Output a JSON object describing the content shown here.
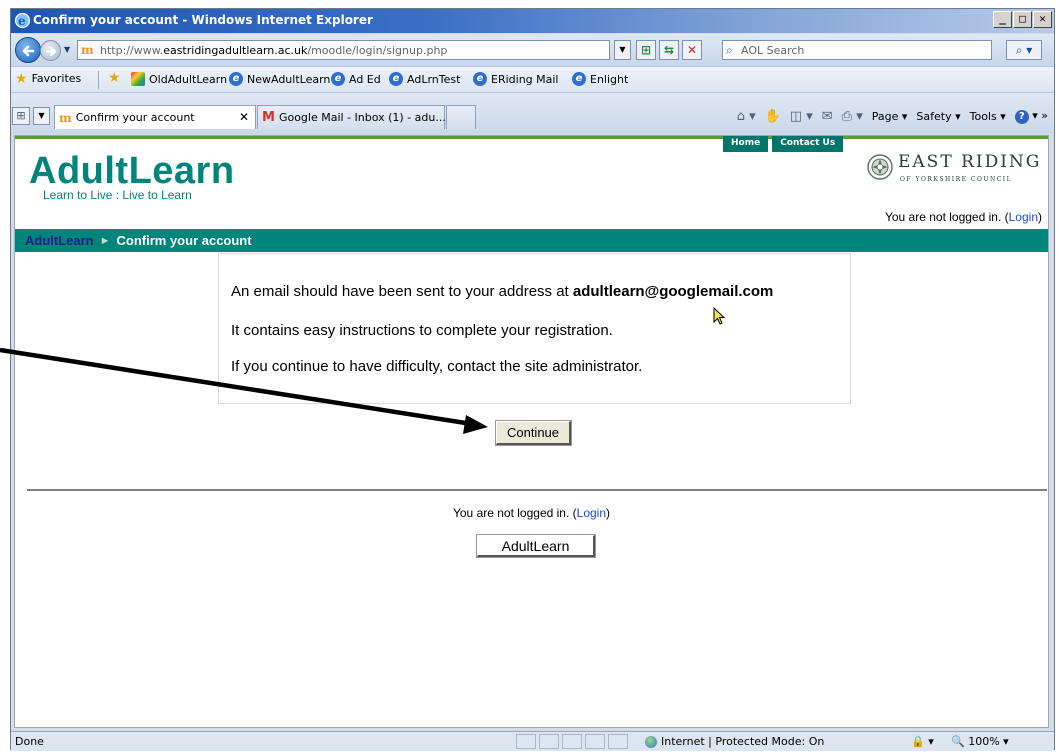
{
  "window": {
    "title": "Confirm your account - Windows Internet Explorer",
    "min_label": "_",
    "max_label": "□",
    "close_label": "✕"
  },
  "address_bar": {
    "url_prefix": "http://www.",
    "url_domain": "eastridingadultlearn.ac.uk",
    "url_path": "/moodle/login/signup.php",
    "search_placeholder": "AOL Search"
  },
  "favorites_bar": {
    "favorites_label": "Favorites",
    "items": [
      {
        "label": "OldAdultLearn",
        "icon": "colorful-icon"
      },
      {
        "label": "NewAdultLearn",
        "icon": "ie-icon"
      },
      {
        "label": "Ad Ed",
        "icon": "ie-icon"
      },
      {
        "label": "AdLrnTest",
        "icon": "ie-icon"
      },
      {
        "label": "ERiding Mail",
        "icon": "ie-icon"
      },
      {
        "label": "Enlight",
        "icon": "ie-icon"
      }
    ]
  },
  "tabs": [
    {
      "label": "Confirm your account",
      "active": true
    },
    {
      "label": "Google Mail - Inbox (1) - adu...",
      "active": false
    }
  ],
  "command_bar": {
    "page": "Page",
    "safety": "Safety",
    "tools": "Tools"
  },
  "site": {
    "top_nav": [
      "Home",
      "Contact Us"
    ],
    "logo_text": "AdultLearn",
    "logo_tagline": "Learn to Live : Live to Learn",
    "council_title": "EAST RIDING",
    "council_subtitle": "OF YORKSHIRE COUNCIL",
    "login_status_prefix": "You are not logged in. (",
    "login_link": "Login",
    "login_status_suffix": ")",
    "breadcrumb_home": "AdultLearn",
    "breadcrumb_sep": "►",
    "breadcrumb_current": "Confirm your account"
  },
  "notice": {
    "line1_prefix": "An email should have been sent to your address at",
    "email": "adultlearn@googlemail.com",
    "line2": "It contains easy instructions to complete your registration.",
    "line3": "If you continue to have difficulty, contact the site administrator."
  },
  "continue_button": "Continue",
  "footer": {
    "login_status_prefix": "You are not logged in. (",
    "login_link": "Login",
    "login_status_suffix": ")",
    "home_button": "AdultLearn"
  },
  "status_bar": {
    "status_text": "Done",
    "zone_text": "Internet | Protected Mode: On",
    "zoom": "100%"
  }
}
